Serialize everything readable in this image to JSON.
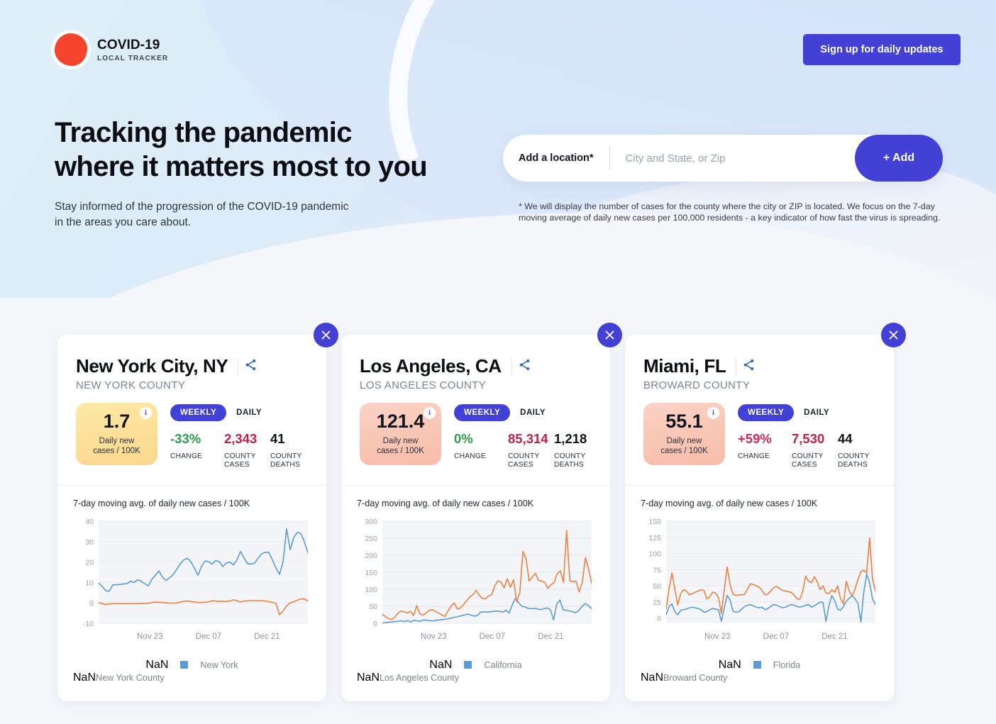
{
  "brand": {
    "title": "COVID-19",
    "subtitle": "LOCAL TRACKER",
    "dot_color": "#f4452c"
  },
  "header": {
    "signup_label": "Sign up for daily updates"
  },
  "hero": {
    "heading_line1": "Tracking the pandemic",
    "heading_line2": "where it matters most to you",
    "subtext_line1": "Stay informed of the progression of the COVID-19 pandemic",
    "subtext_line2": "in the areas you care about.",
    "location_label": "Add a location*",
    "location_placeholder": "City and State, or Zip",
    "location_value": "",
    "add_button_label": "+ Add",
    "disclaimer": "* We will display the number of cases for the county where the city or ZIP is located. We focus on the 7-day moving average of daily new cases per 100,000 residents - a key indicator of how fast the virus is spreading."
  },
  "labels": {
    "change_caption": "CHANGE",
    "county_cases_caption_l1": "COUNTY",
    "county_cases_caption_l2": "CASES",
    "county_deaths_caption_l1": "COUNTY",
    "county_deaths_caption_l2": "DEATHS",
    "metric_caption_l1": "Daily new",
    "metric_caption_l2": "cases / 100K",
    "toggle_weekly": "WEEKLY",
    "toggle_daily": "DAILY",
    "chart_title": "7-day moving avg. of daily new cases / 100K",
    "info_glyph": "i",
    "accent_color": "#4340d6",
    "series_state_color": "#5b9bd5",
    "series_county_color": "#f08040"
  },
  "cards": [
    {
      "city": "New York City, NY",
      "county": "NEW YORK COUNTY",
      "metric_value": "1.7",
      "metric_tone": "yellow",
      "change": "-33%",
      "change_tone": "neg",
      "county_cases": "2,343",
      "county_deaths": "41",
      "chart_data": {
        "type": "line",
        "title": "7-day moving avg. of daily new cases / 100K",
        "xlabel": "",
        "ylabel": "",
        "ylim": [
          -10,
          40
        ],
        "yticks": [
          40,
          30,
          20,
          10,
          0,
          -10
        ],
        "xticks": [
          "Nov 23",
          "Dec 07",
          "Dec 21"
        ],
        "xtick_positions": [
          0.245,
          0.525,
          0.805
        ],
        "grid": true,
        "legend_position": "bottom",
        "series": [
          {
            "name": "New York",
            "color": "#5b9bd5",
            "values": [
              9.6,
              8.2,
              6.0,
              5.7,
              8.8,
              8.9,
              9.0,
              9.3,
              9.4,
              10.6,
              10.0,
              11.3,
              10.6,
              9.4,
              8.3,
              11.5,
              13.5,
              15.6,
              12.6,
              11.0,
              12.2,
              13.8,
              16.4,
              19.1,
              21.0,
              21.9,
              20.2,
              17.0,
              13.5,
              17.8,
              20.5,
              20.2,
              19.0,
              20.8,
              20.2,
              17.8,
              19.5,
              20.0,
              18.6,
              21.0,
              25.2,
              22.0,
              19.2,
              19.0,
              19.5,
              22.0,
              24.0,
              24.8,
              24.7,
              21.0,
              17.0,
              14.0,
              20.0,
              36.3,
              26.0,
              32.0,
              34.5,
              34.0,
              30.0,
              24.4
            ]
          },
          {
            "name": "New York County",
            "color": "#f08040",
            "values": [
              0.1,
              -0.3,
              -0.9,
              -0.5,
              -0.4,
              -0.4,
              -0.4,
              -0.4,
              -0.4,
              -0.4,
              -0.4,
              -0.4,
              -0.3,
              -0.2,
              -0.2,
              0.2,
              0.4,
              0.3,
              0.2,
              0.0,
              -0.1,
              -0.1,
              0.0,
              0.4,
              0.8,
              0.9,
              0.7,
              0.4,
              0.2,
              0.2,
              0.3,
              0.5,
              1.0,
              0.9,
              0.7,
              0.8,
              0.7,
              0.9,
              1.5,
              1.0,
              0.5,
              0.9,
              1.0,
              1.1,
              1.1,
              1.0,
              1.0,
              0.9,
              0.6,
              0.2,
              -0.2,
              -5.8,
              -4.0,
              -1.5,
              0.0,
              0.5,
              1.3,
              1.9,
              2.0,
              0.8
            ]
          }
        ]
      }
    },
    {
      "city": "Los Angeles, CA",
      "county": "LOS ANGELES COUNTY",
      "metric_value": "121.4",
      "metric_tone": "salmon",
      "change": "0%",
      "change_tone": "neg",
      "county_cases": "85,314",
      "county_deaths": "1,218",
      "chart_data": {
        "type": "line",
        "title": "7-day moving avg. of daily new cases / 100K",
        "xlabel": "",
        "ylabel": "",
        "ylim": [
          0,
          300
        ],
        "yticks": [
          300,
          250,
          200,
          150,
          100,
          50,
          0
        ],
        "xticks": [
          "Nov 23",
          "Dec 07",
          "Dec 21"
        ],
        "xtick_positions": [
          0.245,
          0.525,
          0.805
        ],
        "grid": true,
        "legend_position": "bottom",
        "series": [
          {
            "name": "California",
            "color": "#5b9bd5",
            "values": [
              1,
              2,
              3,
              4,
              5,
              6,
              7,
              5,
              8,
              4,
              9,
              7,
              6,
              10,
              9,
              8,
              7,
              9,
              10,
              11,
              12,
              14,
              16,
              18,
              20,
              22,
              25,
              27,
              24,
              21,
              23,
              33,
              34,
              33,
              34,
              35,
              36,
              35,
              33,
              38,
              30,
              55,
              74,
              60,
              50,
              48,
              44,
              43,
              44,
              42,
              40,
              43,
              45,
              40,
              10,
              57,
              68,
              40,
              38,
              36,
              34,
              31,
              38,
              50,
              58,
              52,
              43
            ]
          },
          {
            "name": "Los Angeles County",
            "color": "#f08040",
            "values": [
              26,
              20,
              14,
              11,
              18,
              30,
              36,
              34,
              30,
              35,
              23,
              52,
              28,
              24,
              30,
              38,
              40,
              35,
              30,
              25,
              20,
              36,
              51,
              60,
              42,
              45,
              55,
              66,
              78,
              84,
              97,
              83,
              73,
              72,
              80,
              84,
              110,
              125,
              121,
              104,
              131,
              106,
              128,
              63,
              90,
              211,
              190,
              124,
              136,
              147,
              126,
              124,
              120,
              103,
              113,
              120,
              146,
              154,
              120,
              273,
              125,
              122,
              124,
              92,
              120,
              193,
              160,
              117
            ]
          }
        ]
      }
    },
    {
      "city": "Miami, FL",
      "county": "BROWARD COUNTY",
      "metric_value": "55.1",
      "metric_tone": "salmon",
      "change": "+59%",
      "change_tone": "pos",
      "county_cases": "7,530",
      "county_deaths": "44",
      "chart_data": {
        "type": "line",
        "title": "7-day moving avg. of daily new cases / 100K",
        "xlabel": "",
        "ylabel": "",
        "ylim": [
          -8,
          150
        ],
        "yticks": [
          150,
          125,
          100,
          75,
          50,
          25,
          0
        ],
        "xticks": [
          "Nov 23",
          "Dec 07",
          "Dec 21"
        ],
        "xtick_positions": [
          0.245,
          0.525,
          0.805
        ],
        "grid": true,
        "legend_position": "bottom",
        "series": [
          {
            "name": "Florida",
            "color": "#5b9bd5",
            "values": [
              5,
              18,
              22,
              10,
              5,
              12,
              13,
              14,
              16,
              17,
              16,
              15,
              13,
              9,
              10,
              13,
              15,
              14,
              13,
              -5,
              16,
              35,
              28,
              11,
              9,
              10,
              14,
              18,
              20,
              21,
              19,
              17,
              16,
              17,
              13,
              15,
              18,
              21,
              20,
              18,
              16,
              17,
              19,
              21,
              20,
              18,
              17,
              18,
              20,
              21,
              17,
              19,
              22,
              25,
              24,
              -5,
              19,
              35,
              27,
              14,
              12,
              18,
              26,
              31,
              35,
              30,
              23,
              -6,
              40,
              68,
              55,
              30,
              21
            ]
          },
          {
            "name": "Broward County",
            "color": "#f08040",
            "values": [
              14,
              45,
              70,
              45,
              20,
              38,
              44,
              42,
              36,
              38,
              40,
              42,
              44,
              43,
              30,
              33,
              40,
              39,
              32,
              7,
              44,
              79,
              52,
              37,
              35,
              36,
              36,
              37,
              45,
              53,
              52,
              50,
              48,
              43,
              36,
              37,
              42,
              47,
              49,
              46,
              43,
              42,
              41,
              40,
              36,
              30,
              29,
              41,
              65,
              57,
              55,
              64,
              56,
              44,
              50,
              39,
              38,
              44,
              40,
              50,
              30,
              22,
              57,
              42,
              34,
              45,
              60,
              72,
              74,
              70,
              124,
              60,
              42
            ]
          }
        ]
      }
    }
  ]
}
